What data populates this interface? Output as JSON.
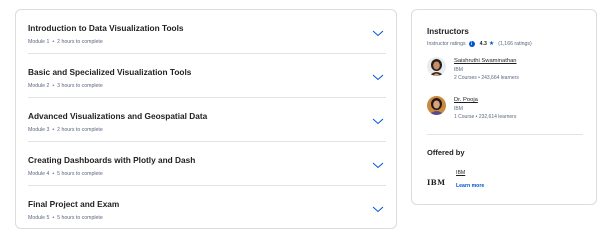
{
  "modules": [
    {
      "title": "Introduction to Data Visualization Tools",
      "module": "Module 1",
      "duration": "2 hours to complete"
    },
    {
      "title": "Basic and Specialized Visualization Tools",
      "module": "Module 2",
      "duration": "3 hours to complete"
    },
    {
      "title": "Advanced Visualizations and Geospatial Data",
      "module": "Module 3",
      "duration": "2 hours to complete"
    },
    {
      "title": "Creating Dashboards with Plotly and Dash",
      "module": "Module 4",
      "duration": "5 hours to complete"
    },
    {
      "title": "Final Project and Exam",
      "module": "Module 5",
      "duration": "5 hours to complete"
    }
  ],
  "sidebar": {
    "heading": "Instructors",
    "ratings_label": "Instructor ratings",
    "rating_value": "4.3",
    "rating_count": "(1,166 ratings)",
    "instructors": [
      {
        "name": "Saishruthi Swaminathan",
        "org": "IBM",
        "stats": "2 Courses • 243,664 learners"
      },
      {
        "name": "Dr. Pooja",
        "org": "IBM",
        "stats": "1 Course • 232,614 learners"
      }
    ],
    "offered_by": "Offered by",
    "partner": {
      "logo_text": "IBM",
      "name": "IBM",
      "learn_more": "Learn more"
    }
  },
  "colors": {
    "accent": "#0056d2",
    "text": "#1f1f1f",
    "muted": "#5b6780",
    "border": "#dadce0"
  },
  "icons": {
    "expand": "chevron-down-icon",
    "info": "info-icon",
    "star": "star-icon"
  }
}
